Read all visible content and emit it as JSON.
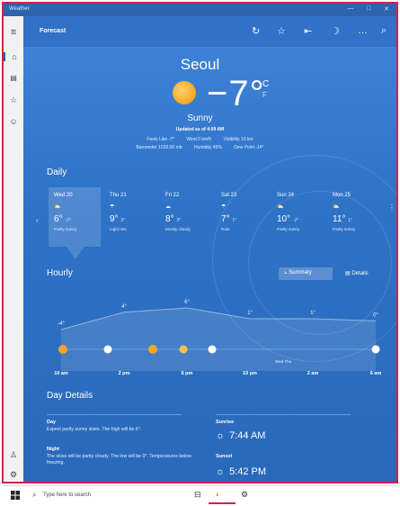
{
  "window": {
    "title": "Weather",
    "controls": [
      "—",
      "□",
      "✕"
    ]
  },
  "rail": {
    "icons": [
      "menu-icon",
      "home-icon",
      "maps-icon",
      "favorites-icon",
      "smile-icon",
      "account-icon",
      "settings-icon"
    ]
  },
  "header": {
    "title": "Forecast",
    "icons": [
      "refresh-icon",
      "favorite-star-icon",
      "pin-icon",
      "dark-mode-icon",
      "more-icon",
      "search-icon"
    ]
  },
  "current": {
    "city": "Seoul",
    "temp": "−7°",
    "unit_c": "C",
    "unit_f": "F",
    "condition": "Sunny",
    "updated": "Updated as of 4:09 AM",
    "feels_like": "Feels Like  -7°",
    "wind": "Wind  0 km/h",
    "visibility": "Visibility  10 km",
    "barometer": "Barometer  1032.00 mb",
    "humidity": "Humidity  45%",
    "dew_point": "Dew Point  -14°"
  },
  "daily": {
    "title": "Daily",
    "days": [
      {
        "name": "Wed 20",
        "hi": "6°",
        "lo": "-3°",
        "desc": "Partly sunny",
        "icon": "partly-sunny-icon"
      },
      {
        "name": "Thu 21",
        "hi": "9°",
        "lo": "3°",
        "desc": "Light rain",
        "icon": "rain-icon"
      },
      {
        "name": "Fri 22",
        "hi": "8°",
        "lo": "3°",
        "desc": "Mostly cloudy",
        "icon": "cloudy-icon"
      },
      {
        "name": "Sat 23",
        "hi": "7°",
        "lo": "1°",
        "desc": "Rain",
        "icon": "rain-icon"
      },
      {
        "name": "Sun 24",
        "hi": "10°",
        "lo": "-2°",
        "desc": "Partly sunny",
        "icon": "partly-sunny-icon"
      },
      {
        "name": "Mon 25",
        "hi": "11°",
        "lo": "1°",
        "desc": "Partly sunny",
        "icon": "partly-sunny-icon"
      }
    ]
  },
  "hourly": {
    "title": "Hourly",
    "summary_label": "Summary",
    "details_label": "Details",
    "temps": [
      -4,
      4,
      6,
      1,
      1,
      0
    ],
    "temp_labels": [
      "-4°",
      "4°",
      "6°",
      "1°",
      "1°",
      "0°"
    ],
    "times": [
      "10 am",
      "2 pm",
      "6 pm",
      "10 pm",
      "2 am",
      "6 am"
    ],
    "day_marker": "Wed  Thu"
  },
  "details": {
    "title": "Day Details",
    "day_head": "Day",
    "day_text": "Expect partly sunny skies. The high will be 6°.",
    "night_head": "Night",
    "night_text": "The skies will be partly cloudy. The low will be 0°. Temperatures below freezing.",
    "sunrise_head": "Sunrise",
    "sunrise": "7:44 AM",
    "sunset_head": "Sunset",
    "sunset": "5:42 PM"
  },
  "taskbar": {
    "search_placeholder": "Type here to search"
  },
  "colors": {
    "accent": "#2f6fc0",
    "border": "#d3234a",
    "sun": "#f5a623"
  }
}
